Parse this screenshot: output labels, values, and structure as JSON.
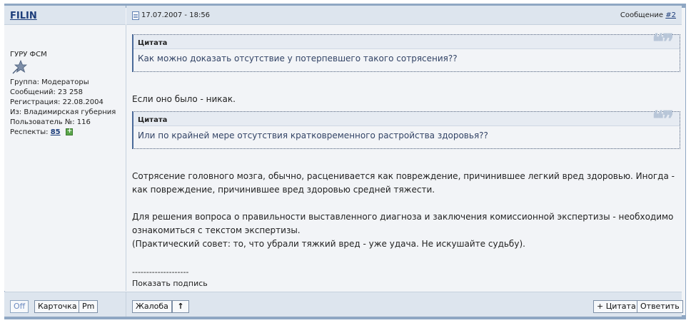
{
  "author": {
    "name": "FILIN",
    "rank": "ГУРУ ФСМ",
    "group": "Группа: Модераторы",
    "posts": "Сообщений: 23 258",
    "registration": "Регистрация: 22.08.2004",
    "location": "Из: Владимирская губерния",
    "user_number": "Пользователь №: 116",
    "respect_label": "Респекты: ",
    "respect_value": "85"
  },
  "post": {
    "date": "17.07.2007 - 18:56",
    "number_label": "Сообщение ",
    "number_link": "#2",
    "quote_label": "Цитата",
    "quote1": "Как можно доказать отсутствие у потерпевшего такого сотрясения??",
    "text1": "Если оно было - никак.",
    "quote2": "Или по крайней мере отсутствия кратковременного растройства здоровья??",
    "para1_line1": "Сотрясение головного мозга, обычно, расценивается как повреждение, причинившее легкий вред здоровью. Иногда -",
    "para1_line2": "как повреждение, причинившее вред здоровью средней тяжести.",
    "para2_line1": "Для решения вопроса о правильности выставленного диагноза и заключения комиссионной экспертизы - необходимо",
    "para2_line2": "ознакомиться с текстом экспертизы.",
    "para2_line3": "(Практический совет: то, что убрали тяжкий вред - уже удача. Не искушайте судьбу).",
    "separator": "--------------------",
    "signature_toggle": "Показать подпись"
  },
  "footer": {
    "status": "Off",
    "card": "Карточка",
    "pm": "Pm",
    "report": "Жалоба",
    "up": "↑",
    "quote_button": "+ Цитата",
    "reply": "Ответить"
  },
  "colors": {
    "header_bg": "#dde5ee",
    "panel_bg": "#f2f4f7",
    "border": "#8fa7c3",
    "link": "#1c3d7a"
  }
}
